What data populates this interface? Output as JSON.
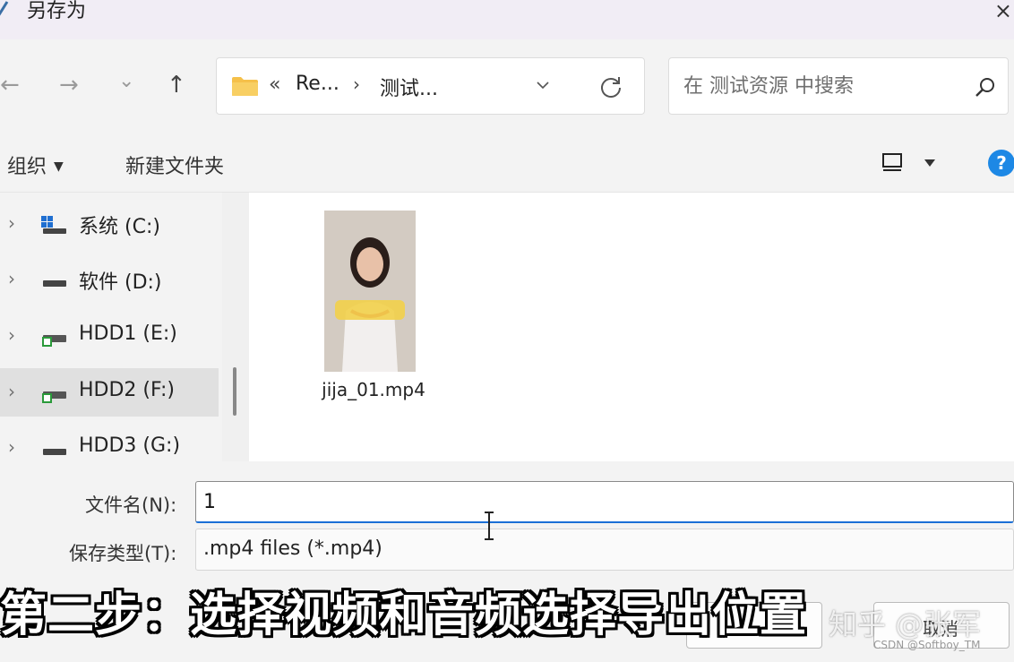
{
  "window": {
    "title": "另存为",
    "close_glyph": "×"
  },
  "nav": {
    "back_glyph": "←",
    "forward_glyph": "→",
    "recent_glyph": "⌄",
    "up_glyph": "↑",
    "breadcrumb": {
      "prefix": "«",
      "items": [
        "Re...",
        "测试..."
      ],
      "separator": "›"
    },
    "search_placeholder": "在 测试资源 中搜索"
  },
  "toolbar": {
    "organize_label": "组织",
    "organize_caret": "▼",
    "new_folder_label": "新建文件夹",
    "help_label": "?"
  },
  "sidebar": {
    "items": [
      {
        "label": "系统 (C:)",
        "icon": "windows-drive-icon"
      },
      {
        "label": "软件 (D:)",
        "icon": "drive-icon"
      },
      {
        "label": "HDD1 (E:)",
        "icon": "external-drive-icon"
      },
      {
        "label": "HDD2 (F:)",
        "icon": "external-drive-icon",
        "selected": true
      },
      {
        "label": "HDD3 (G:)",
        "icon": "drive-icon"
      }
    ],
    "expand_glyph": "›"
  },
  "files": [
    {
      "name": "jija_01.mp4",
      "type": "video-thumbnail"
    }
  ],
  "form": {
    "filename_label": "文件名(N):",
    "filename_value": "1",
    "filetype_label": "保存类型(T):",
    "filetype_value": ".mp4 files (*.mp4)"
  },
  "overlay": {
    "caption": "第二步：选择视频和音频选择导出位置",
    "cancel_label": "取消",
    "watermark_zhihu": "知乎 @张军",
    "watermark_csdn": "CSDN @Softboy_TM"
  },
  "colors": {
    "accent": "#1a6fd6",
    "help": "#1d88e5",
    "folder": "#f5c04a",
    "selected_row": "#e0e0e0"
  }
}
